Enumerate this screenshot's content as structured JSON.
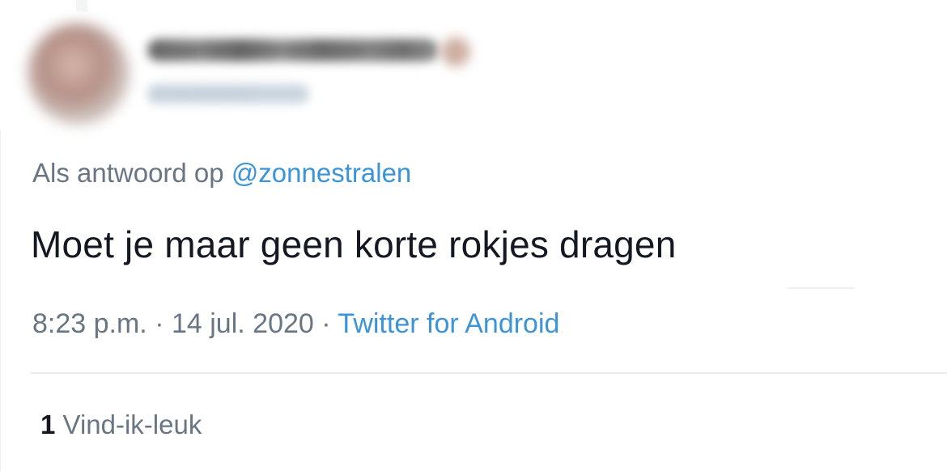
{
  "author": {
    "name": "Maarten Verschoor",
    "handle": "@vandaantje",
    "avatar_icon": "user-avatar-photo",
    "badge_icon": "emoji-badge"
  },
  "reply_to": {
    "prefix": "Als antwoord op",
    "handle": "@zonnestralen"
  },
  "tweet": {
    "text": "Moet je maar geen korte rokjes dragen"
  },
  "meta": {
    "time": "8:23 p.m.",
    "sep1": "·",
    "date": "14 jul. 2020",
    "sep2": "·",
    "source": "Twitter for Android"
  },
  "stats": {
    "like_count": "1",
    "like_label": "Vind-ik-leuk"
  },
  "colors": {
    "text": "#141823",
    "secondary": "#687684",
    "link": "#3b94d9",
    "divider": "#e6ecf0"
  }
}
